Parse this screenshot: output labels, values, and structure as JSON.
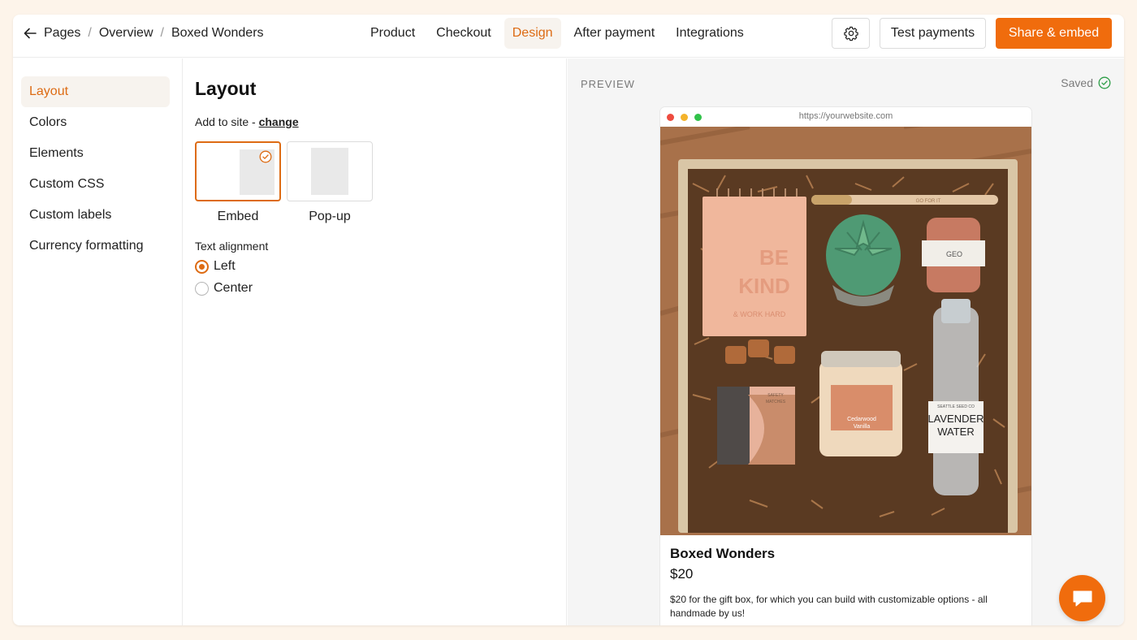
{
  "breadcrumb": {
    "items": [
      "Pages",
      "Overview",
      "Boxed Wonders"
    ]
  },
  "nav": {
    "tabs": [
      "Product",
      "Checkout",
      "Design",
      "After payment",
      "Integrations"
    ],
    "active": "Design"
  },
  "actions": {
    "test_label": "Test payments",
    "share_label": "Share & embed"
  },
  "sidebar": {
    "items": [
      {
        "label": "Layout"
      },
      {
        "label": "Colors"
      },
      {
        "label": "Elements"
      },
      {
        "label": "Custom CSS"
      },
      {
        "label": "Custom labels"
      },
      {
        "label": "Currency formatting"
      }
    ],
    "active": "Layout"
  },
  "panel": {
    "title": "Layout",
    "add_site_prefix": "Add to site - ",
    "add_site_link": "change",
    "options": [
      {
        "label": "Embed",
        "selected": true
      },
      {
        "label": "Pop-up",
        "selected": false
      }
    ],
    "alignment_label": "Text alignment",
    "alignments": [
      {
        "label": "Left",
        "checked": true
      },
      {
        "label": "Center",
        "checked": false
      }
    ]
  },
  "preview": {
    "label": "PREVIEW",
    "saved_label": "Saved",
    "url": "https://yourwebsite.com",
    "product": {
      "name": "Boxed Wonders",
      "price": "$20",
      "description": "$20 for the gift box, for which you can build with customizable options - all handmade by us!",
      "image_text": {
        "notebook": "BE KIND",
        "notebook_sub": "& WORK HARD",
        "pen": "GO FOR IT",
        "soap": "GEO",
        "matches": "SAFETY MATCHES",
        "candle": "Cedarwood Vanilla",
        "bottle_brand": "SEATTLE SEED CO",
        "bottle": "LAVENDER WATER"
      }
    }
  },
  "colors": {
    "accent": "#dd6b13",
    "brand": "#f06c0d",
    "background": "#fdf4ea"
  },
  "icons": [
    "arrow-left-icon",
    "gear-icon",
    "check-circle-icon",
    "chat-icon"
  ]
}
